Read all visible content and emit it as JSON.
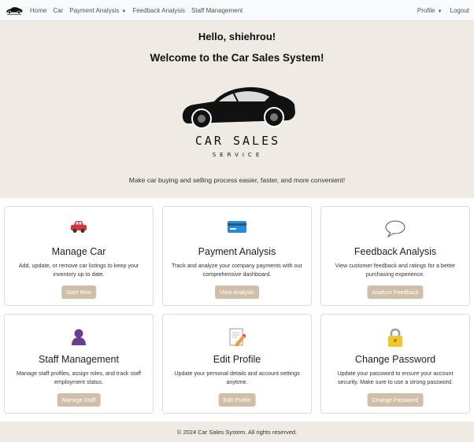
{
  "nav": {
    "items": [
      {
        "label": "Home"
      },
      {
        "label": "Car"
      },
      {
        "label": "Payment Analysis",
        "dropdown": true
      },
      {
        "label": "Feedback Analysis"
      },
      {
        "label": "Staff Management"
      }
    ],
    "profile_label": "Profile",
    "logout_label": "Logout"
  },
  "hero": {
    "greeting": "Hello, shiehrou!",
    "welcome": "Welcome to the Car Sales System!",
    "logo_text_line1": "CAR SALES",
    "logo_text_line2": "SERVICE",
    "tagline": "Make car buying and selling process easier, faster, and more convenient!"
  },
  "cards": [
    {
      "icon": "car-icon",
      "title": "Manage Car",
      "desc": "Add, update, or remove car listings to keep your inventory up to date.",
      "button": "Start Now"
    },
    {
      "icon": "credit-card-icon",
      "title": "Payment Analysis",
      "desc": "Track and analyze your company payments with our comprehensive dashboard.",
      "button": "View Analysis"
    },
    {
      "icon": "speech-bubble-icon",
      "title": "Feedback Analysis",
      "desc": "View customer feedback and ratings for a better purchasing experience.",
      "button": "Analyze Feedback"
    },
    {
      "icon": "person-icon",
      "title": "Staff Management",
      "desc": "Manage staff profiles, assign roles, and track staff employment status.",
      "button": "Manage Staff"
    },
    {
      "icon": "memo-icon",
      "title": "Edit Profile",
      "desc": "Update your personal details and account settings anytime.",
      "button": "Edit Profile"
    },
    {
      "icon": "lock-icon",
      "title": "Change Password",
      "desc": "Update your password to ensure your account security. Make sure to use a strong password.",
      "button": "Change Password"
    }
  ],
  "footer": {
    "text": "© 2024 Car Sales System. All rights reserved."
  },
  "colors": {
    "hero_bg": "#efebe4",
    "button_bg": "#d0bfa8",
    "nav_bg": "#f8f9fa"
  }
}
